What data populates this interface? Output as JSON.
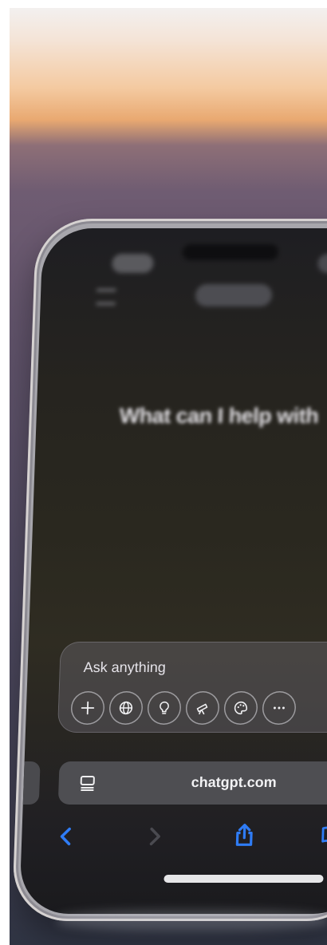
{
  "screen": {
    "headline": "What can I help with",
    "composer": {
      "placeholder": "Ask anything",
      "tools": [
        {
          "icon": "plus-icon"
        },
        {
          "icon": "globe-icon"
        },
        {
          "icon": "lightbulb-icon"
        },
        {
          "icon": "telescope-icon"
        },
        {
          "icon": "palette-icon"
        },
        {
          "icon": "more-icon"
        }
      ]
    },
    "browser": {
      "url": "chatgpt.com",
      "accent": "#2f7cf6"
    }
  }
}
